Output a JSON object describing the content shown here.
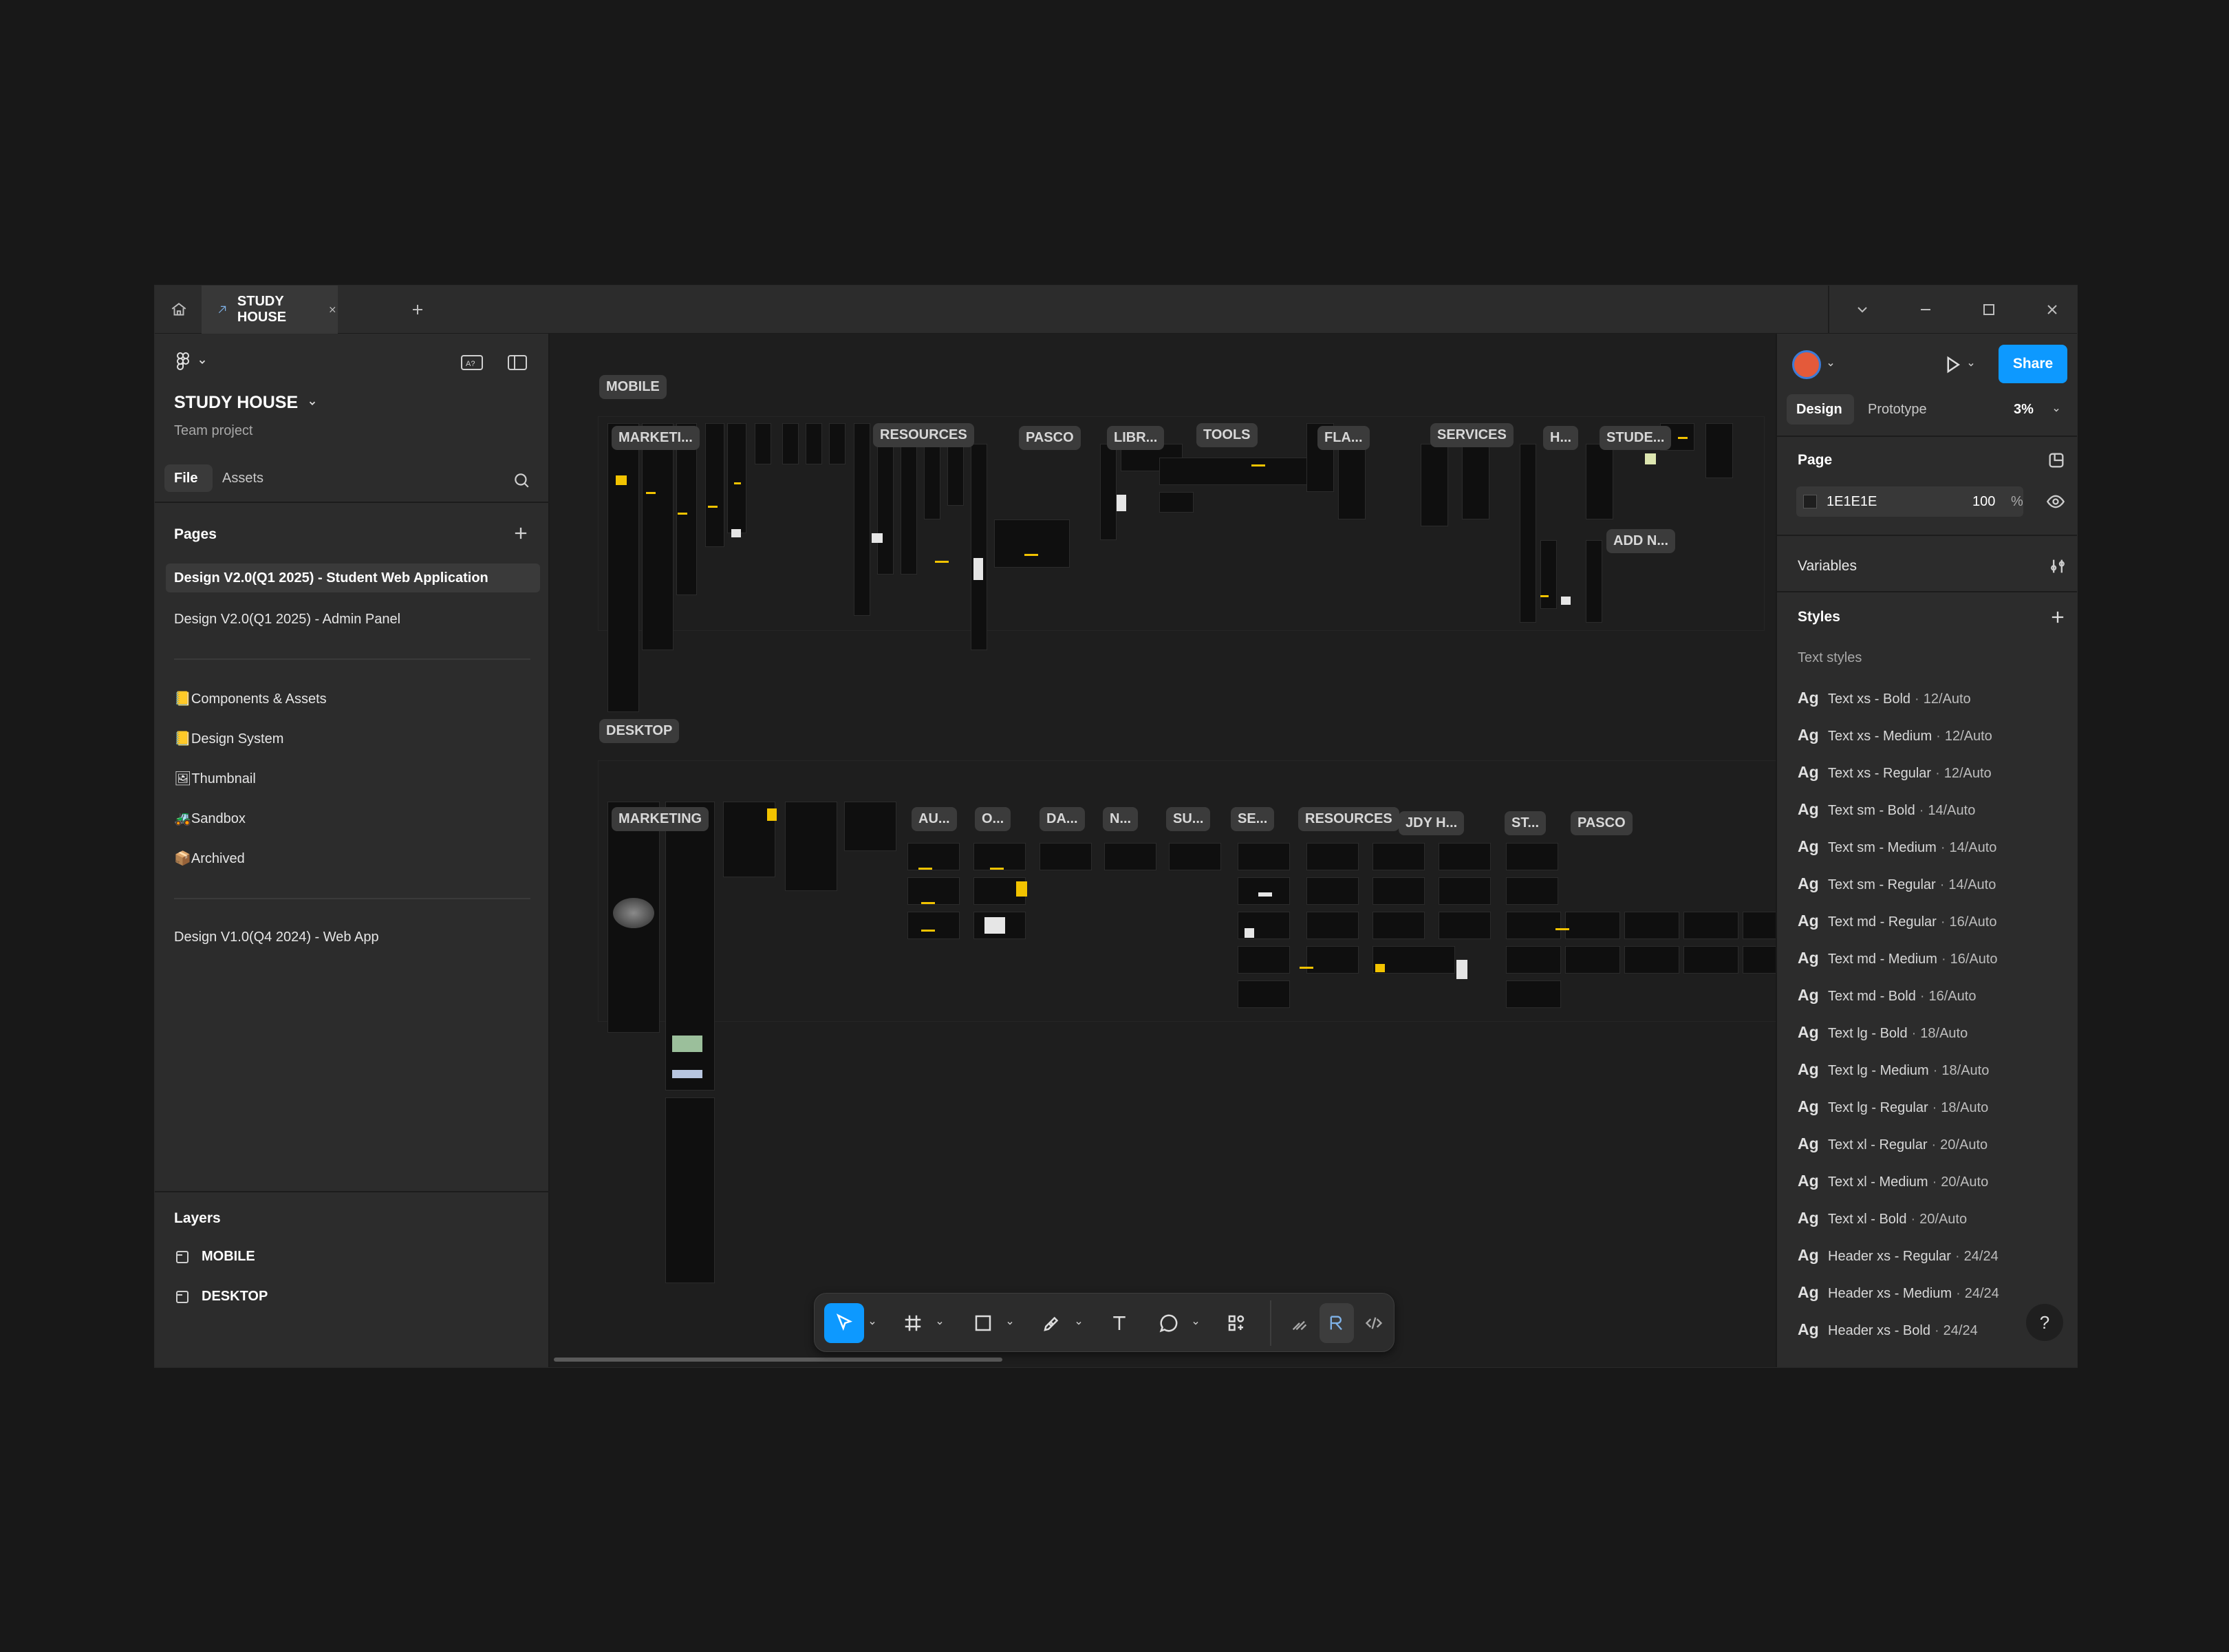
{
  "tab": {
    "title": "STUDY HOUSE"
  },
  "file": {
    "name": "STUDY HOUSE",
    "subtitle": "Team project"
  },
  "left_tabs": {
    "file": "File",
    "assets": "Assets"
  },
  "pages": {
    "heading": "Pages",
    "items": [
      "Design V2.0(Q1 2025) - Student Web Application",
      "Design V2.0(Q1 2025) - Admin Panel",
      "📒Components & Assets",
      "📒Design System",
      "🖼Thumbnail",
      "🚜Sandbox",
      "📦Archived",
      "Design V1.0(Q4 2024) - Web App"
    ]
  },
  "layers": {
    "heading": "Layers",
    "items": [
      "MOBILE",
      "DESKTOP"
    ]
  },
  "canvas": {
    "sections": [
      "MOBILE",
      "DESKTOP"
    ],
    "mobile_labels": [
      "MARKETI...",
      "RESOURCES",
      "PASCO",
      "LIBR...",
      "TOOLS",
      "FLA...",
      "SERVICES",
      "H...",
      "STUDE...",
      "ADD N..."
    ],
    "desktop_labels": [
      "MARKETING",
      "AU...",
      "O...",
      "DA...",
      "N...",
      "SU...",
      "SE...",
      "RESOURCES",
      "JDY H...",
      "ST...",
      "PASCO"
    ]
  },
  "right": {
    "share": "Share",
    "tabs": {
      "design": "Design",
      "prototype": "Prototype"
    },
    "zoom": "3%",
    "page": {
      "heading": "Page",
      "color": "1E1E1E",
      "opacity": "100",
      "unit": "%"
    },
    "variables": "Variables",
    "styles": "Styles",
    "text_styles": "Text styles",
    "text_style_items": [
      {
        "name": "Text xs - Bold",
        "spec": "12/Auto"
      },
      {
        "name": "Text xs - Medium",
        "spec": "12/Auto"
      },
      {
        "name": "Text xs - Regular",
        "spec": "12/Auto"
      },
      {
        "name": "Text sm - Bold",
        "spec": "14/Auto"
      },
      {
        "name": "Text sm - Medium",
        "spec": "14/Auto"
      },
      {
        "name": "Text sm - Regular",
        "spec": "14/Auto"
      },
      {
        "name": "Text md - Regular",
        "spec": "16/Auto"
      },
      {
        "name": "Text md - Medium",
        "spec": "16/Auto"
      },
      {
        "name": "Text md - Bold",
        "spec": "16/Auto"
      },
      {
        "name": "Text lg - Bold",
        "spec": "18/Auto"
      },
      {
        "name": "Text lg - Medium",
        "spec": "18/Auto"
      },
      {
        "name": "Text lg - Regular",
        "spec": "18/Auto"
      },
      {
        "name": "Text xl - Regular",
        "spec": "20/Auto"
      },
      {
        "name": "Text xl - Medium",
        "spec": "20/Auto"
      },
      {
        "name": "Text xl - Bold",
        "spec": "20/Auto"
      },
      {
        "name": "Header xs - Regular",
        "spec": "24/24"
      },
      {
        "name": "Header xs - Medium",
        "spec": "24/24"
      },
      {
        "name": "Header xs - Bold",
        "spec": "24/24"
      }
    ],
    "style_prefix": "Ag",
    "help": "?"
  },
  "colors": {
    "accent": "#0d99ff",
    "highlight": "#f2c300",
    "swatch": "#1E1E1E"
  }
}
